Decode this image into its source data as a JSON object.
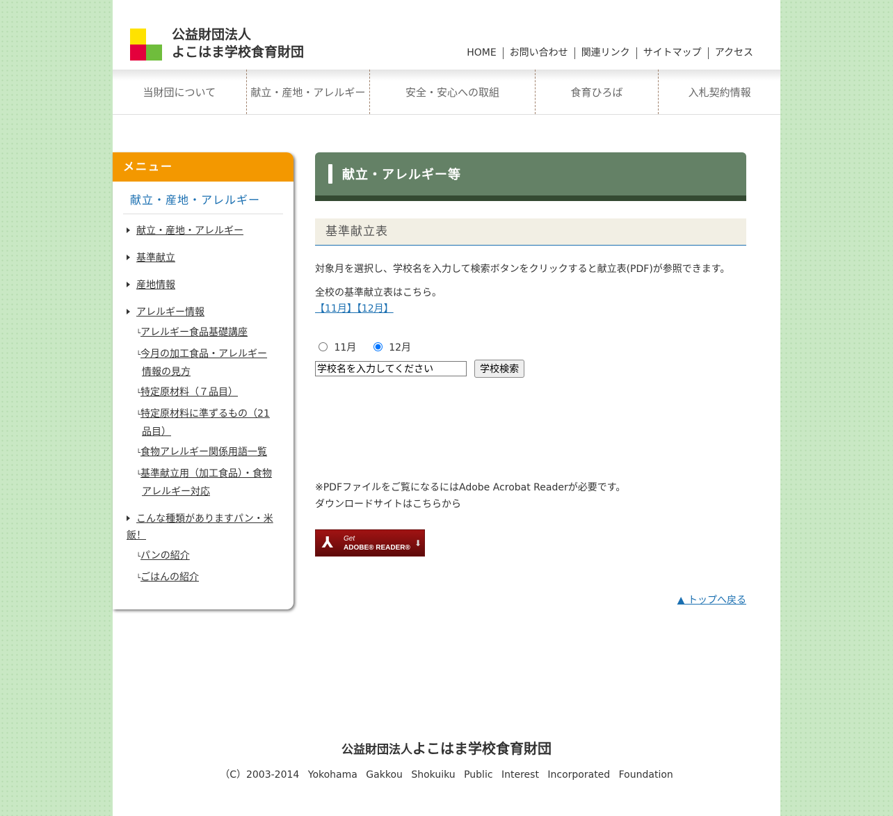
{
  "header": {
    "logo_line1": "公益財団法人",
    "logo_line2": "よこはま学校食育財団",
    "toplinks": [
      "HOME",
      "お問い合わせ",
      "関連リンク",
      "サイトマップ",
      "アクセス"
    ]
  },
  "gnav": [
    "当財団について",
    "献立・産地・アレルギー",
    "安全・安心への取組",
    "食育ひろば",
    "入札契約情報"
  ],
  "sidebar": {
    "head": "メニュー",
    "title": "献立・産地・アレルギー",
    "items": [
      {
        "label": "献立・産地・アレルギー"
      },
      {
        "label": "基準献立"
      },
      {
        "label": "産地情報"
      },
      {
        "label": "アレルギー情報"
      }
    ],
    "allergy_sub": [
      "アレルギー食品基礎講座",
      "今月の加工食品・アレルギー情報の見方",
      "特定原材料（７品目）",
      "特定原材料に準ずるもの（21品目）",
      "食物アレルギー関係用語一覧",
      "基準献立用（加工食品）・食物アレルギー対応"
    ],
    "bread_item": "こんな種類がありますパン・米飯！",
    "bread_sub": [
      "パンの紹介",
      "ごはんの紹介"
    ]
  },
  "main": {
    "h1": "献立・アレルギー等",
    "h2": "基準献立表",
    "intro": "対象月を選択し、学校名を入力して検索ボタンをクリックすると献立表(PDF)が参照できます。",
    "all_schools": "全校の基準献立表はこちら。",
    "month_links": "【11月】【12月】",
    "radio_nov": "11月",
    "radio_dec": "12月",
    "search_placeholder": "学校名を入力してください",
    "search_button": "学校検索",
    "pdf_note": "※PDFファイルをご覧になるにはAdobe Acrobat Readerが必要です。",
    "download_note": "ダウンロードサイトはこちらから",
    "adobe_get": "Get",
    "adobe_reader": "ADOBE® READER®",
    "back_to_top": "▲ トップへ戻る"
  },
  "footer": {
    "org_prefix": "公益財団法人",
    "org_name": "よこはま学校食育財団",
    "copyright": "（C）2003-2014 Yokohama Gakkou Shokuiku Public Interest Incorporated Foundation"
  }
}
